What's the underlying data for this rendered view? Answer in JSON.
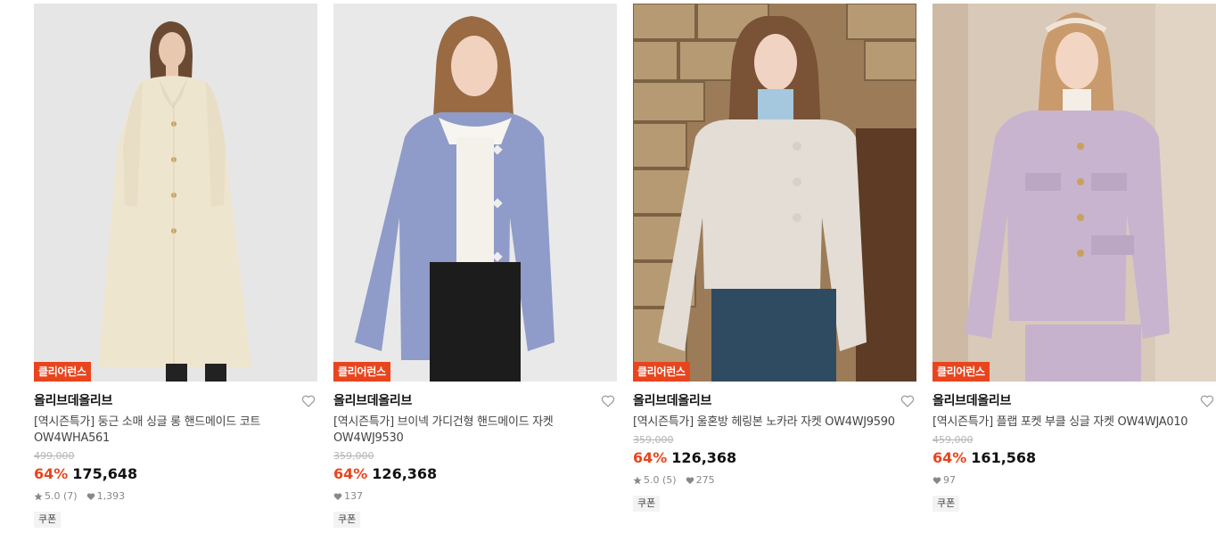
{
  "products": [
    {
      "badge": "클리어런스",
      "brand": "올리브데올리브",
      "title": "[역시즌특가] 둥근 소매 싱글 롱 핸드메이드 코트 OW4WHA561",
      "original_price": "499,000",
      "discount": "64%",
      "price": "175,648",
      "rating": "5.0",
      "reviews": "(7)",
      "likes": "1,393",
      "coupon": "쿠폰"
    },
    {
      "badge": "클리어런스",
      "brand": "올리브데올리브",
      "title": "[역시즌특가] 브이넥 가디건형 핸드메이드 자켓 OW4WJ9530",
      "original_price": "359,000",
      "discount": "64%",
      "price": "126,368",
      "rating": "",
      "reviews": "",
      "likes": "137",
      "coupon": "쿠폰"
    },
    {
      "badge": "클리어런스",
      "brand": "올리브데올리브",
      "title": "[역시즌특가] 울혼방 헤링본 노카라 자켓 OW4WJ9590",
      "original_price": "359,000",
      "discount": "64%",
      "price": "126,368",
      "rating": "5.0",
      "reviews": "(5)",
      "likes": "275",
      "coupon": "쿠폰"
    },
    {
      "badge": "클리어런스",
      "brand": "올리브데올리브",
      "title": "[역시즌특가] 플랩 포켓 부클 싱글 자켓 OW4WJA010",
      "original_price": "459,000",
      "discount": "64%",
      "price": "161,568",
      "rating": "",
      "reviews": "",
      "likes": "97",
      "coupon": "쿠폰"
    }
  ],
  "colors": {
    "accent": "#e8451e",
    "coat_1": "#eee5cf",
    "jacket_2": "#8f9bc8",
    "jacket_3": "#e3ddd6",
    "jacket_4": "#c8b4cf"
  },
  "icons": {
    "wishlist": "heart-outline-icon",
    "rating": "star-icon",
    "likes": "heart-filled-icon"
  }
}
